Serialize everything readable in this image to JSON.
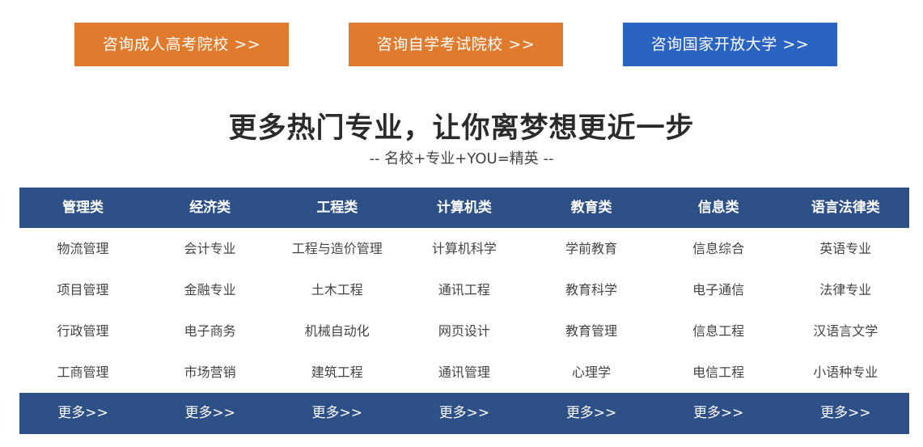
{
  "buttons": [
    {
      "label": "咨询成人高考院校 >>",
      "color": "#e07b2e"
    },
    {
      "label": "咨询自学考试院校 >>",
      "color": "#e07b2e"
    },
    {
      "label": "咨询国家开放大学 >>",
      "color": "#2a63c2"
    }
  ],
  "headline": "更多热门专业，让你离梦想更近一步",
  "tagline": "-- 名校+专业+YOU=精英 --",
  "categories": [
    {
      "title": "管理类",
      "items": [
        "物流管理",
        "项目管理",
        "行政管理",
        "工商管理"
      ],
      "more": "更多>>"
    },
    {
      "title": "经济类",
      "items": [
        "会计专业",
        "金融专业",
        "电子商务",
        "市场营销"
      ],
      "more": "更多>>"
    },
    {
      "title": "工程类",
      "items": [
        "工程与造价管理",
        "土木工程",
        "机械自动化",
        "建筑工程"
      ],
      "more": "更多>>"
    },
    {
      "title": "计算机类",
      "items": [
        "计算机科学",
        "通讯工程",
        "网页设计",
        "通讯管理"
      ],
      "more": "更多>>"
    },
    {
      "title": "教育类",
      "items": [
        "学前教育",
        "教育科学",
        "教育管理",
        "心理学"
      ],
      "more": "更多>>"
    },
    {
      "title": "信息类",
      "items": [
        "信息综合",
        "电子通信",
        "信息工程",
        "电信工程"
      ],
      "more": "更多>>"
    },
    {
      "title": "语言法律类",
      "items": [
        "英语专业",
        "法律专业",
        "汉语言文学",
        "小语种专业"
      ],
      "more": "更多>>"
    }
  ],
  "colors": {
    "header_bg": "#2d5086",
    "orange": "#e07b2e",
    "blue": "#2a63c2"
  }
}
